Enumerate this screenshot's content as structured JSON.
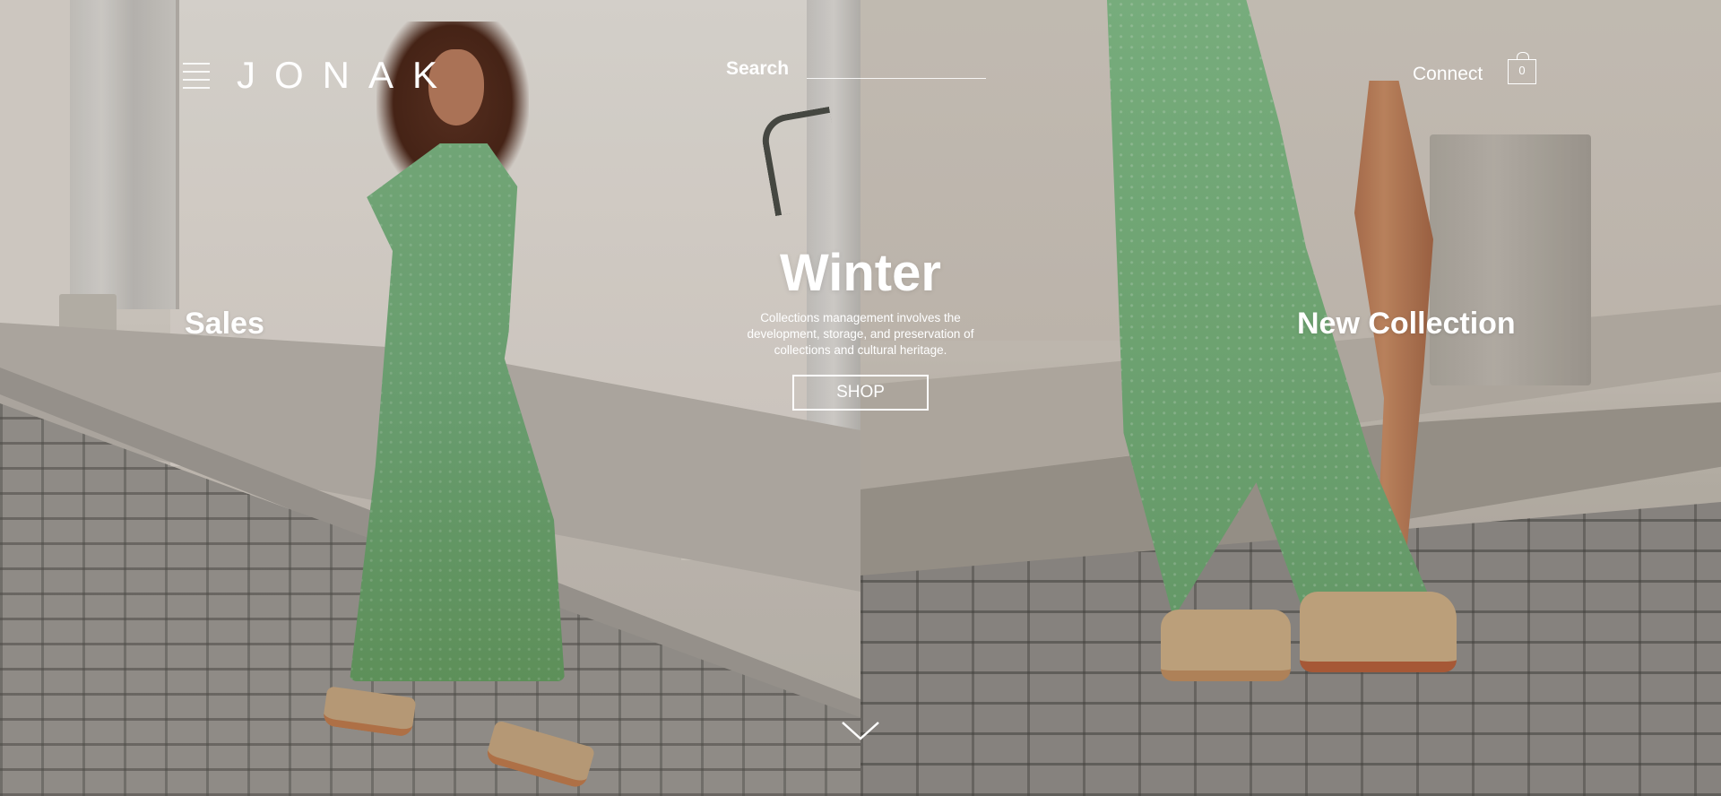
{
  "brand": {
    "logo_text": "JONAK"
  },
  "header": {
    "search_label": "Search",
    "search_value": "",
    "connect_label": "Connect",
    "cart_count": "0"
  },
  "hero": {
    "left_label": "Sales",
    "right_label": "New Collection",
    "title": "Winter",
    "description": "Collections management involves the development, storage, and preservation of collections and cultural heritage.",
    "cta_label": "SHOP"
  },
  "icons": {
    "menu": "hamburger-menu-icon",
    "cart": "shopping-bag-icon",
    "scroll": "chevron-down-icon"
  },
  "colors": {
    "text": "#ffffff",
    "dress_green": "#74ad78"
  }
}
